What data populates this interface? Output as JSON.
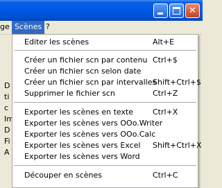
{
  "menubar": {
    "cut_label": "ge",
    "scenes_label": "Scènes",
    "help_label": "?"
  },
  "left_panel_letters": [
    "D",
    "ti",
    "c",
    "Im",
    "D",
    "Fi",
    "A"
  ],
  "menu": {
    "items": [
      {
        "label": "Editer les scènes",
        "shortcut": "Alt+E"
      },
      {
        "label": "Créer un fichier scn par contenu",
        "shortcut": "Ctrl+$"
      },
      {
        "label": "Créer un fichier scn selon date",
        "shortcut": ""
      },
      {
        "label": "Créer un fichier scn par intervalles",
        "shortcut": "Shift+Ctrl+$"
      },
      {
        "label": "Supprimer le fichier scn",
        "shortcut": "Ctrl+Z"
      },
      {
        "label": "Exporter les scènes en texte",
        "shortcut": "Ctrl+X"
      },
      {
        "label": "Exporter les scènes vers OOo.Writer",
        "shortcut": ""
      },
      {
        "label": "Exporter les scènes vers OOo.Calc",
        "shortcut": ""
      },
      {
        "label": "Exporter les scènes vers Excel",
        "shortcut": "Shift+Ctrl+X"
      },
      {
        "label": "Exporter les scènes vers Word",
        "shortcut": ""
      },
      {
        "label": "Découper en scènes",
        "shortcut": "Ctrl+C"
      }
    ]
  },
  "colors": {
    "titlebar": "#0058e6",
    "menu_highlight": "#316ac5",
    "close_button": "#c44420"
  }
}
